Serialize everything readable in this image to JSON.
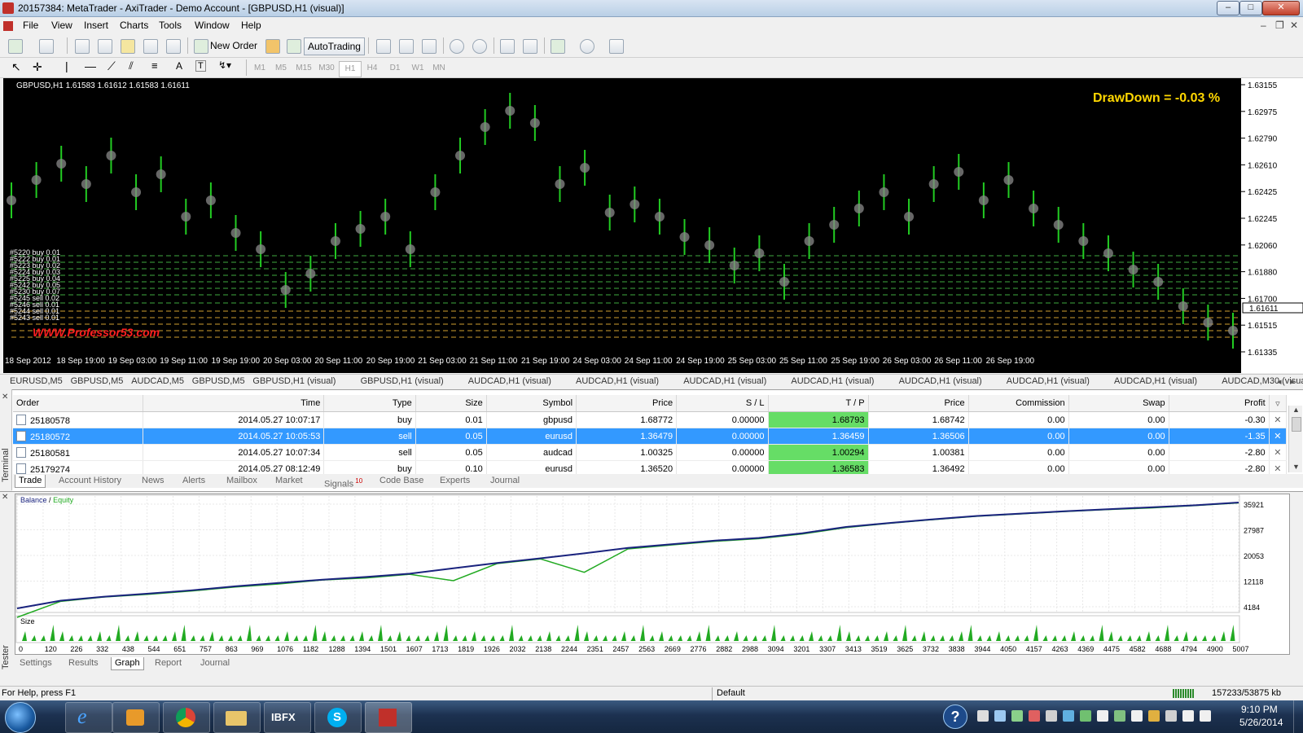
{
  "window": {
    "title": "20157384: MetaTrader - AxiTrader - Demo Account - [GBPUSD,H1 (visual)]",
    "controls": [
      "–",
      "□",
      "✕"
    ]
  },
  "menu": [
    "File",
    "View",
    "Insert",
    "Charts",
    "Tools",
    "Window",
    "Help"
  ],
  "toolbar": {
    "new_order": "New Order",
    "autotrading": "AutoTrading",
    "timeframes": [
      "M1",
      "M5",
      "M15",
      "M30",
      "H1",
      "H4",
      "D1",
      "W1",
      "MN"
    ]
  },
  "chart": {
    "header": "GBPUSD,H1  1.61583 1.61612 1.61583 1.61611",
    "drawdown": "DrawDown = -0.03 %",
    "watermark": "WWW.Professor53.com",
    "current_price": "1.61611",
    "price_ticks": [
      "1.63155",
      "1.62975",
      "1.62790",
      "1.62610",
      "1.62425",
      "1.62245",
      "1.62060",
      "1.61880",
      "1.61700",
      "1.61515",
      "1.61335"
    ],
    "time_ticks": [
      "18 Sep 2012",
      "18 Sep 19:00",
      "19 Sep 03:00",
      "19 Sep 11:00",
      "19 Sep 19:00",
      "20 Sep 03:00",
      "20 Sep 11:00",
      "20 Sep 19:00",
      "21 Sep 03:00",
      "21 Sep 11:00",
      "21 Sep 19:00",
      "24 Sep 03:00",
      "24 Sep 11:00",
      "24 Sep 19:00",
      "25 Sep 03:00",
      "25 Sep 11:00",
      "25 Sep 19:00",
      "26 Sep 03:00",
      "26 Sep 11:00",
      "26 Sep 19:00"
    ],
    "order_labels": [
      "#5220 buy 0.01",
      "#5222 buy 0.01",
      "#5223 buy 0.02",
      "#5224 buy 0.03",
      "#5225 buy 0.04",
      "#5242 buy 0.05",
      "#5230 buy 0.07",
      "#5245 sell 0.02",
      "#5246 sell 0.01",
      "#5244 sell 0.01",
      "#5243 sell 0.01"
    ],
    "colors": {
      "background": "#000000",
      "drawdown": "#ffd700",
      "watermark": "#ff2020",
      "candles": "#22cc22"
    }
  },
  "chart_tabs": [
    "EURUSD,M5",
    "GBPUSD,M5",
    "AUDCAD,M5",
    "GBPUSD,M5",
    "GBPUSD,H1 (visual)",
    "GBPUSD,H1 (visual)",
    "AUDCAD,H1 (visual)",
    "AUDCAD,H1 (visual)",
    "AUDCAD,H1 (visual)",
    "AUDCAD,H1 (visual)",
    "AUDCAD,H1 (visual)",
    "AUDCAD,H1 (visual)",
    "AUDCAD,H1 (visual)",
    "AUDCAD,M30 (visual)",
    "AUDC"
  ],
  "terminal": {
    "side_label": "Terminal",
    "columns": [
      "Order",
      "Time",
      "Type",
      "Size",
      "Symbol",
      "Price",
      "S / L",
      "T / P",
      "Price",
      "Commission",
      "Swap",
      "Profit"
    ],
    "rows": [
      {
        "order": "25180578",
        "time": "2014.05.27 10:07:17",
        "type": "buy",
        "size": "0.01",
        "symbol": "gbpusd",
        "price": "1.68772",
        "sl": "0.00000",
        "tp": "1.68793",
        "cur_price": "1.68742",
        "commission": "0.00",
        "swap": "0.00",
        "profit": "-0.30"
      },
      {
        "order": "25180572",
        "time": "2014.05.27 10:05:53",
        "type": "sell",
        "size": "0.05",
        "symbol": "eurusd",
        "price": "1.36479",
        "sl": "0.00000",
        "tp": "1.36459",
        "cur_price": "1.36506",
        "commission": "0.00",
        "swap": "0.00",
        "profit": "-1.35"
      },
      {
        "order": "25180581",
        "time": "2014.05.27 10:07:34",
        "type": "sell",
        "size": "0.05",
        "symbol": "audcad",
        "price": "1.00325",
        "sl": "0.00000",
        "tp": "1.00294",
        "cur_price": "1.00381",
        "commission": "0.00",
        "swap": "0.00",
        "profit": "-2.80"
      },
      {
        "order": "25179274",
        "time": "2014.05.27 08:12:49",
        "type": "buy",
        "size": "0.10",
        "symbol": "eurusd",
        "price": "1.36520",
        "sl": "0.00000",
        "tp": "1.36583",
        "cur_price": "1.36492",
        "commission": "0.00",
        "swap": "0.00",
        "profit": "-2.80"
      }
    ],
    "tabs": [
      "Trade",
      "Account History",
      "News",
      "Alerts",
      "Mailbox",
      "Market",
      "Signals",
      "Code Base",
      "Experts",
      "Journal"
    ],
    "signals_badge": "10"
  },
  "tester": {
    "side_label": "Tester",
    "legend_balance": "Balance",
    "legend_sep": "/",
    "legend_equity": "Equity",
    "size_label": "Size",
    "tabs": [
      "Settings",
      "Results",
      "Graph",
      "Report",
      "Journal"
    ]
  },
  "chart_data": {
    "type": "line",
    "title": "",
    "series": [
      {
        "name": "Balance",
        "values": [
          4184,
          6500,
          7700,
          8600,
          9600,
          10800,
          11800,
          12800,
          13600,
          14600,
          16200,
          17800,
          19200,
          20700,
          22300,
          23400,
          24500,
          25300,
          26700,
          28600,
          29800,
          30900,
          31900,
          32600,
          33300,
          33900,
          34500,
          35100,
          35921
        ]
      },
      {
        "name": "Equity",
        "values": [
          1500,
          6300,
          7600,
          8400,
          9400,
          10600,
          11500,
          12700,
          13300,
          14400,
          12500,
          17600,
          19000,
          15000,
          22000,
          23200,
          24300,
          25100,
          26500,
          28400,
          29700,
          30800,
          31800,
          32500,
          33200,
          33800,
          34300,
          35000,
          35800
        ]
      }
    ],
    "x": [
      0,
      120,
      226,
      332,
      438,
      544,
      651,
      757,
      863,
      969,
      1076,
      1182,
      1288,
      1394,
      1501,
      1607,
      1713,
      1819,
      1926,
      2032,
      2138,
      2244,
      2351,
      2457,
      2563,
      2669,
      2776,
      2882,
      2988
    ],
    "x_ticks": [
      "0",
      "120",
      "226",
      "332",
      "438",
      "544",
      "651",
      "757",
      "863",
      "969",
      "1076",
      "1182",
      "1288",
      "1394",
      "1501",
      "1607",
      "1713",
      "1819",
      "1926",
      "2032",
      "2138",
      "2244",
      "2351",
      "2457",
      "2563",
      "2669",
      "2776",
      "2882",
      "2988",
      "3094",
      "3201",
      "3307",
      "3413",
      "3519",
      "3625",
      "3732",
      "3838",
      "3944",
      "4050",
      "4157",
      "4263",
      "4369",
      "4475",
      "4582",
      "4688",
      "4794",
      "4900",
      "5007"
    ],
    "y_ticks": [
      "35921",
      "27987",
      "20053",
      "12118",
      "4184"
    ],
    "ylim": [
      4184,
      35921
    ],
    "colors": {
      "balance": "#1a237e",
      "equity": "#22aa22"
    }
  },
  "status": {
    "help": "For Help, press F1",
    "profile": "Default",
    "traffic": "157233/53875 kb"
  },
  "taskbar": {
    "tray_time": "9:10 PM",
    "tray_date": "5/26/2014",
    "apps": [
      "start-orb",
      "internet-explorer",
      "media-player",
      "chrome",
      "file-explorer",
      "ibfx",
      "skype",
      "metatrader"
    ],
    "ibfx_label": "IBFX"
  }
}
